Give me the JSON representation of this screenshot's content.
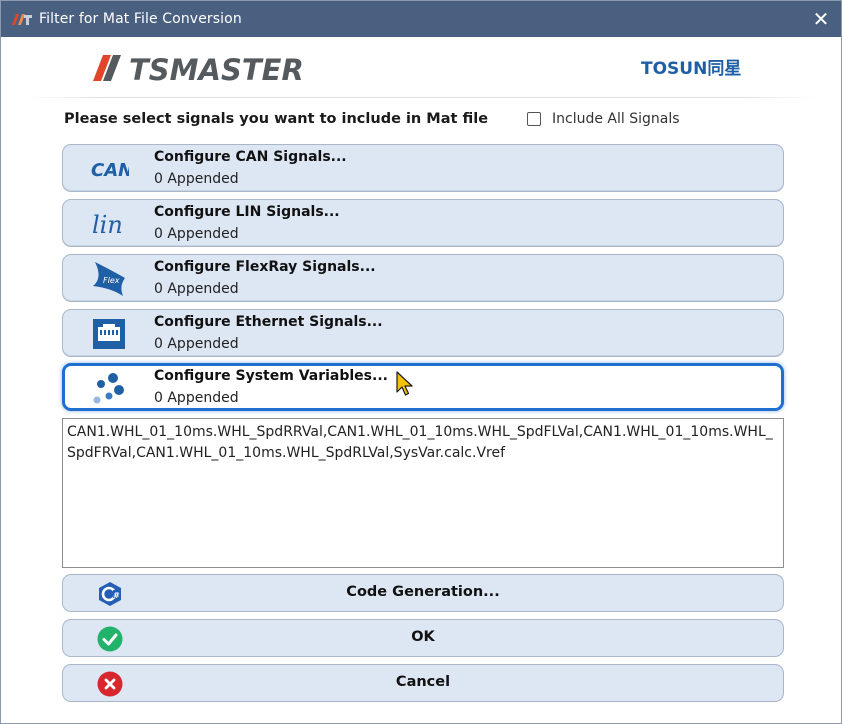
{
  "window": {
    "title": "Filter for Mat File Conversion",
    "close_glyph": "✕"
  },
  "logos": {
    "left": "TSMASTER",
    "right": "TOSUN同星"
  },
  "prompt": "Please select signals you want to include in Mat file",
  "include_all": {
    "label": "Include All Signals",
    "checked": false
  },
  "signal_groups": [
    {
      "title": "Configure CAN Signals...",
      "count": "0 Appended",
      "icon": "can-icon",
      "icon_text": "CAN"
    },
    {
      "title": "Configure LIN Signals...",
      "count": "0 Appended",
      "icon": "lin-icon",
      "icon_text": "lin"
    },
    {
      "title": "Configure FlexRay Signals...",
      "count": "0 Appended",
      "icon": "flexray-icon",
      "icon_text": "Flex"
    },
    {
      "title": "Configure Ethernet Signals...",
      "count": "0 Appended",
      "icon": "ethernet-icon"
    },
    {
      "title": "Configure System Variables...",
      "count": "0 Appended",
      "icon": "system-variables-icon"
    }
  ],
  "selected_signals_text": "CAN1.WHL_01_10ms.WHL_SpdRRVal,CAN1.WHL_01_10ms.WHL_SpdFLVal,CAN1.WHL_01_10ms.WHL_SpdFRVal,CAN1.WHL_01_10ms.WHL_SpdRLVal,SysVar.calc.Vref",
  "actions": {
    "code_generation": "Code Generation...",
    "ok": "OK",
    "cancel": "Cancel"
  },
  "colors": {
    "titlebar": "#4a6080",
    "button_bg": "#dde6f3",
    "active_border": "#1f6fd0",
    "ok_green": "#22b36b",
    "cancel_red": "#d8262e",
    "logo_red": "#e2462a",
    "logo_gray": "#555a5f",
    "tosun_blue": "#1f5fa6"
  }
}
